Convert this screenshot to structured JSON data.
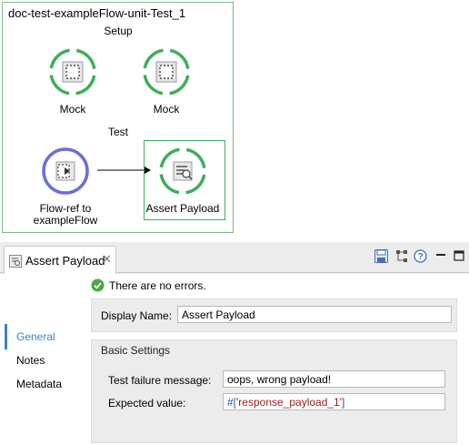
{
  "flow": {
    "title": "doc-test-exampleFlow-unit-Test_1",
    "setup_label": "Setup",
    "test_label": "Test",
    "mock1_label": "Mock",
    "mock2_label": "Mock",
    "flowref_label_line1": "Flow-ref to",
    "flowref_label_line2": "exampleFlow",
    "assert_label": "Assert Payload",
    "colors": {
      "mock_ring": "#3fae5a",
      "flowref_ring": "#6b6fd6",
      "selected_border": "#3fae5a"
    }
  },
  "editor": {
    "tab_label": "Assert Payload",
    "tab_close": "✕",
    "toolbar": [
      "save-icon",
      "tree-icon",
      "help-icon",
      "minimize-icon",
      "maximize-icon"
    ],
    "sidebar": {
      "items": [
        "General",
        "Notes",
        "Metadata"
      ],
      "active": "General",
      "accent": "#3a84c6"
    },
    "status": {
      "icon": "check-circle-icon",
      "text": "There are no errors."
    },
    "display_name": {
      "label": "Display Name:",
      "value": "Assert Payload"
    },
    "basic_settings": {
      "title": "Basic Settings",
      "failure_label": "Test failure message:",
      "failure_value": "oops, wrong payload!",
      "expected_label": "Expected value:",
      "expected_prefix": "#[",
      "expected_string": "'response_payload_1'",
      "expected_suffix": "]"
    }
  }
}
